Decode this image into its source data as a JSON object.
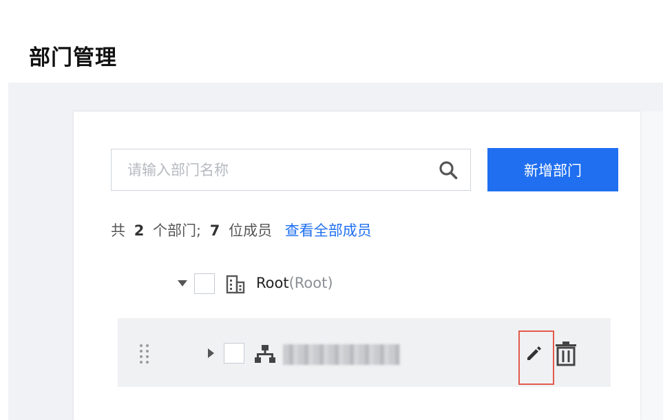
{
  "page": {
    "title": "部门管理"
  },
  "search": {
    "placeholder": "请输入部门名称",
    "value": ""
  },
  "actions": {
    "add_department_label": "新增部门"
  },
  "summary": {
    "prefix": "共",
    "department_count": "2",
    "department_unit": "个部门;",
    "member_count": "7",
    "member_unit": "位成员",
    "view_all_link": "查看全部成员"
  },
  "tree": {
    "root": {
      "name": "Root",
      "tag": "(Root)",
      "expanded": true,
      "checked": false
    },
    "children": [
      {
        "name": "",
        "expanded": false,
        "checked": false
      }
    ]
  },
  "icons": {
    "search": "search-icon",
    "root_department": "building-icon",
    "child_department": "org-chart-icon",
    "drag": "drag-handle-icon",
    "edit": "pencil-icon",
    "delete": "trash-icon"
  },
  "colors": {
    "primary": "#1f6ff0",
    "highlight_outline": "#e25a4a",
    "row_background": "#f0f1f3"
  }
}
